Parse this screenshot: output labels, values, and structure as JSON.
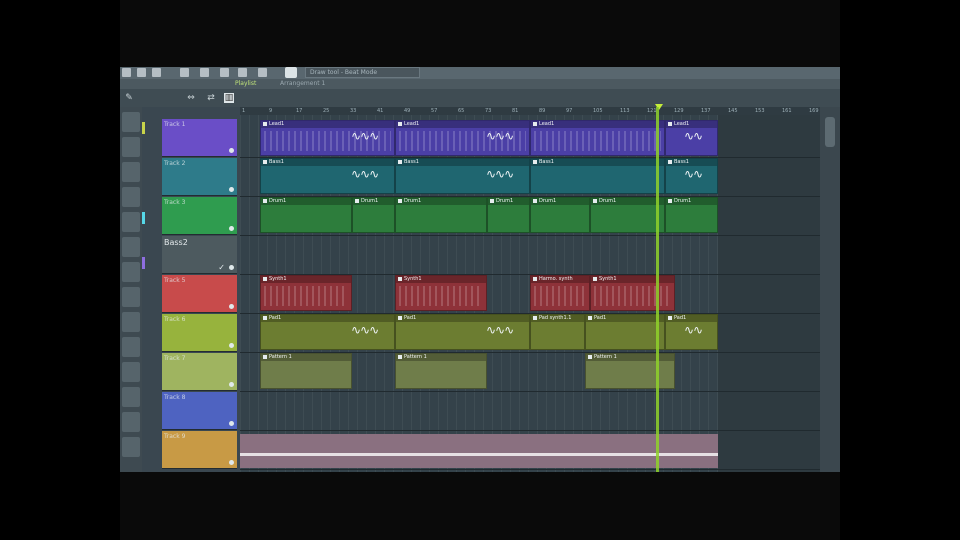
{
  "toolbar": {
    "icons": [
      "new-icon",
      "open-icon",
      "save-icon",
      "record-icon",
      "mic-icon",
      "cut-icon",
      "magnet-icon",
      "tools-icon"
    ],
    "hint": "Draw tool - Beat Mode"
  },
  "playlist": {
    "title": "Playlist",
    "subtitle": "Arrangement 1"
  },
  "ruler": [
    "1",
    "9",
    "17",
    "25",
    "33",
    "41",
    "49",
    "57",
    "65",
    "73",
    "81",
    "89",
    "97",
    "105",
    "113",
    "121",
    "129",
    "137",
    "145",
    "153",
    "161",
    "169"
  ],
  "tracks": [
    {
      "name": "Track 1",
      "color": "#6a4ec7"
    },
    {
      "name": "Track 2",
      "color": "#2e7b8a"
    },
    {
      "name": "Track 3",
      "color": "#2f9c4f"
    },
    {
      "name": "Bass2",
      "color": "#4d5a5f"
    },
    {
      "name": "Track 5",
      "color": "#c84b4b"
    },
    {
      "name": "Track 6",
      "color": "#97b33d"
    },
    {
      "name": "Track 7",
      "color": "#9fb460"
    },
    {
      "name": "Track 8",
      "color": "#4e63c1"
    },
    {
      "name": "Track 9",
      "color": "#c89a45"
    }
  ],
  "clips": {
    "lead": [
      "Lead1",
      "Lead1",
      "Lead1",
      "Lead1"
    ],
    "bass": [
      "Bass1",
      "Bass1",
      "Bass1",
      "Bass1"
    ],
    "drum": [
      "Drum1",
      "Drum1",
      "Drum1",
      "Drum1",
      "Drum1",
      "Drum1",
      "Drum1"
    ],
    "synth": [
      "Synth1",
      "Synth1",
      "Harmo. synth",
      "Synth1"
    ],
    "pad": [
      "Pad1",
      "Pad1",
      "Pad1",
      "Pad synth1.1",
      "Pad1",
      "Pad1"
    ],
    "pattern": [
      "Pattern 1",
      "Pattern 1",
      "Pattern 1"
    ]
  },
  "colors": {
    "lead_clip": "#4b3fa6",
    "bass_clip": "#1f6670",
    "drum_clip": "#2d7d3c",
    "synth_clip": "#8e3239",
    "pad_clip": "#6c7d31",
    "pattern_clip": "#6f7d4a",
    "playhead": "#8fd12a"
  }
}
